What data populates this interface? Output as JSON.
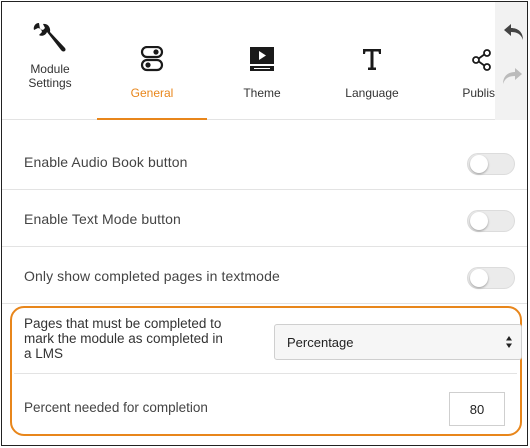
{
  "header": {
    "module_settings_line1": "Module",
    "module_settings_line2": "Settings",
    "tabs": [
      {
        "label": "General",
        "icon": "toggles-icon",
        "active": true
      },
      {
        "label": "Theme",
        "icon": "theme-icon",
        "active": false
      },
      {
        "label": "Language",
        "icon": "text-t-icon",
        "active": false
      },
      {
        "label": "Publish",
        "icon": "share-icon",
        "active": false
      }
    ]
  },
  "settings": [
    {
      "label": "Enable Audio Book button",
      "enabled": false
    },
    {
      "label": "Enable Text Mode button",
      "enabled": false
    },
    {
      "label": "Only show completed pages in textmode",
      "enabled": false
    }
  ],
  "completion": {
    "label_line1": "Pages that must be completed to",
    "label_line2": "mark the module as completed in",
    "label_line3": "a LMS",
    "selected": "Percentage",
    "percent_label": "Percent needed for completion",
    "percent_value": "80"
  },
  "colors": {
    "accent": "#e8861b",
    "toggle_off": "#ebebeb",
    "divider": "#e3e3e3"
  }
}
